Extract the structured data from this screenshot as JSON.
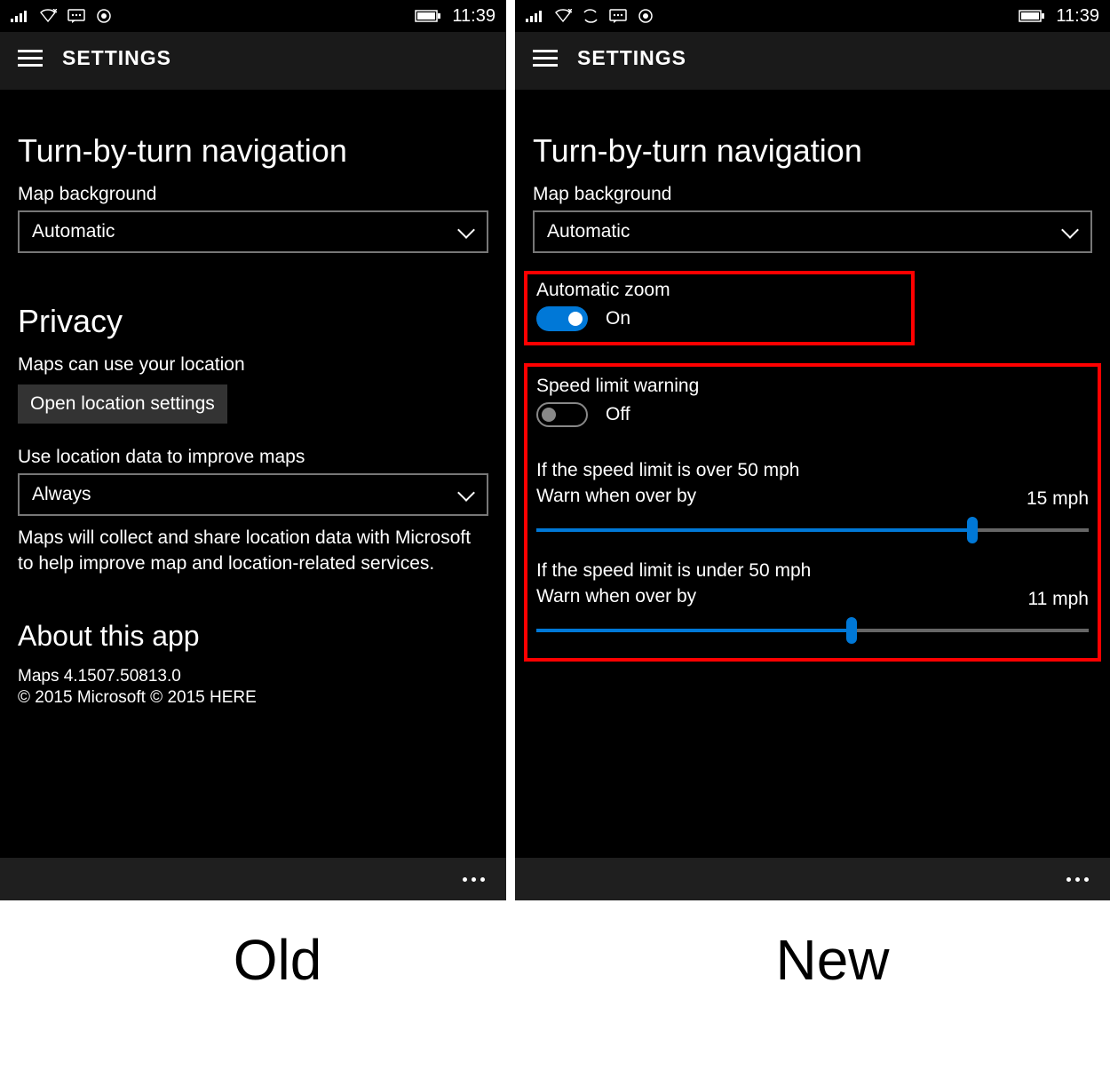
{
  "left": {
    "status": {
      "time": "11:39"
    },
    "header": {
      "title": "SETTINGS"
    },
    "section1_heading": "Turn-by-turn navigation",
    "map_bg_label": "Map background",
    "map_bg_value": "Automatic",
    "section2_heading": "Privacy",
    "location_label": "Maps can use your location",
    "location_button": "Open location settings",
    "improve_label": "Use location data to improve maps",
    "improve_value": "Always",
    "disclaimer": "Maps will collect and share location data with Microsoft to help improve map and location-related services.",
    "section3_heading": "About this app",
    "version": "Maps 4.1507.50813.0",
    "copyright": "© 2015 Microsoft © 2015 HERE"
  },
  "right": {
    "status": {
      "time": "11:39"
    },
    "header": {
      "title": "SETTINGS"
    },
    "section1_heading": "Turn-by-turn navigation",
    "map_bg_label": "Map background",
    "map_bg_value": "Automatic",
    "autozoom_label": "Automatic zoom",
    "autozoom_state": "On",
    "speedlimit_label": "Speed limit warning",
    "speedlimit_state": "Off",
    "over50_line1": "If the speed limit is over 50 mph",
    "over50_line2": "Warn when over by",
    "over50_value": "15 mph",
    "over50_percent": 79,
    "under50_line1": "If the speed limit is under 50 mph",
    "under50_line2": "Warn when over by",
    "under50_value": "11 mph",
    "under50_percent": 57
  },
  "caption": {
    "left": "Old",
    "right": "New"
  }
}
